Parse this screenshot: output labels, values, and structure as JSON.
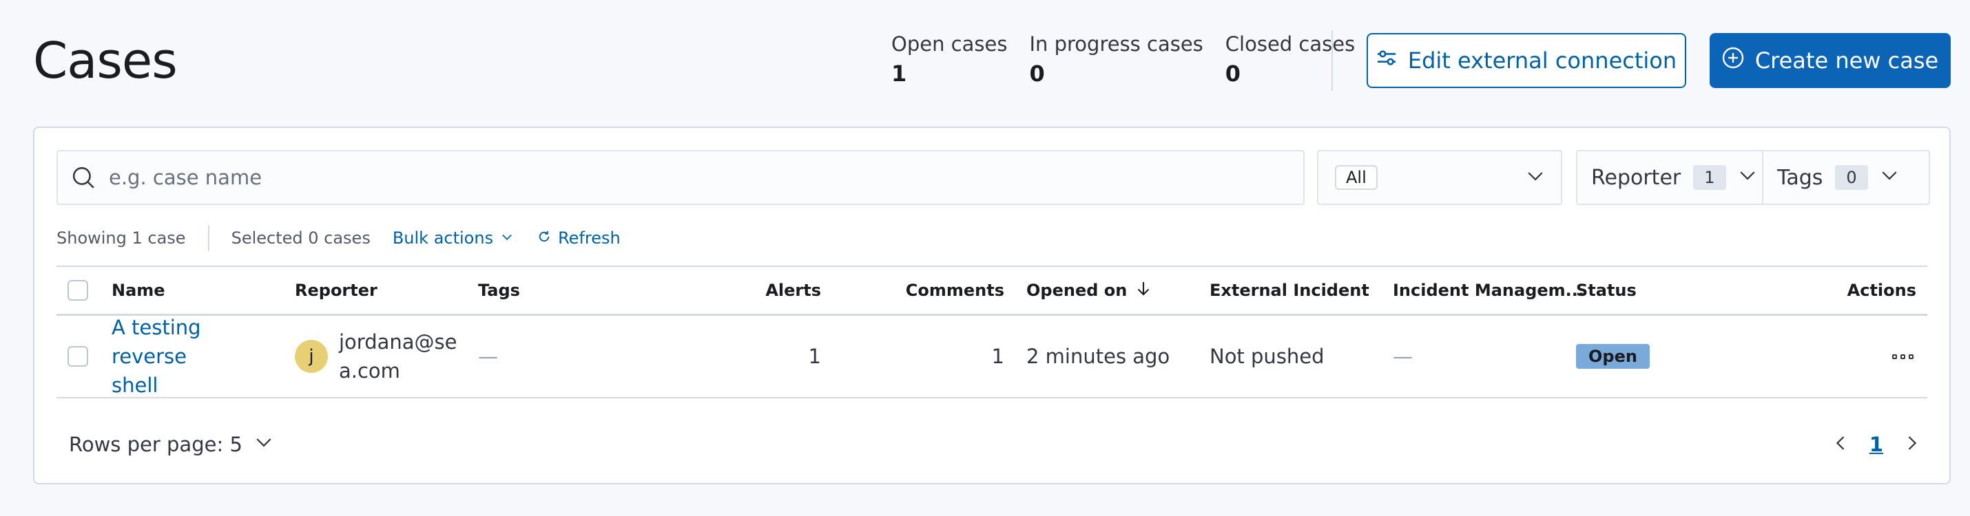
{
  "page": {
    "title": "Cases"
  },
  "stats": [
    {
      "label": "Open cases",
      "value": "1"
    },
    {
      "label": "In progress cases",
      "value": "0"
    },
    {
      "label": "Closed cases",
      "value": "0"
    }
  ],
  "header_buttons": {
    "edit_connection": "Edit external connection",
    "create_case": "Create new case"
  },
  "filters": {
    "search_placeholder": "e.g. case name",
    "status_selected": "All",
    "reporter_label": "Reporter",
    "reporter_count": "1",
    "tags_label": "Tags",
    "tags_count": "0"
  },
  "utility_bar": {
    "showing": "Showing 1 case",
    "selected": "Selected 0 cases",
    "bulk_actions": "Bulk actions",
    "refresh": "Refresh"
  },
  "table": {
    "columns": {
      "name": "Name",
      "reporter": "Reporter",
      "tags": "Tags",
      "alerts": "Alerts",
      "comments": "Comments",
      "opened_on": "Opened on",
      "external_incident": "External Incident",
      "incident_management": "Incident Managem...",
      "status": "Status",
      "actions": "Actions"
    },
    "rows": [
      {
        "name_line1": "A testing reverse",
        "name_line2": "shell",
        "reporter_initial": "j",
        "reporter_line1": "jordana@se",
        "reporter_line2": "a.com",
        "tags": "—",
        "alerts": "1",
        "comments": "1",
        "opened_on": "2 minutes ago",
        "external_incident": "Not pushed",
        "incident_management": "—",
        "status": "Open"
      }
    ]
  },
  "pagination": {
    "rows_per_page": "Rows per page: 5",
    "current_page": "1"
  },
  "colors": {
    "primary": "#0b64b5",
    "link": "#0061a6",
    "status_open": "#79aad9",
    "avatar": "#e7cf73"
  }
}
